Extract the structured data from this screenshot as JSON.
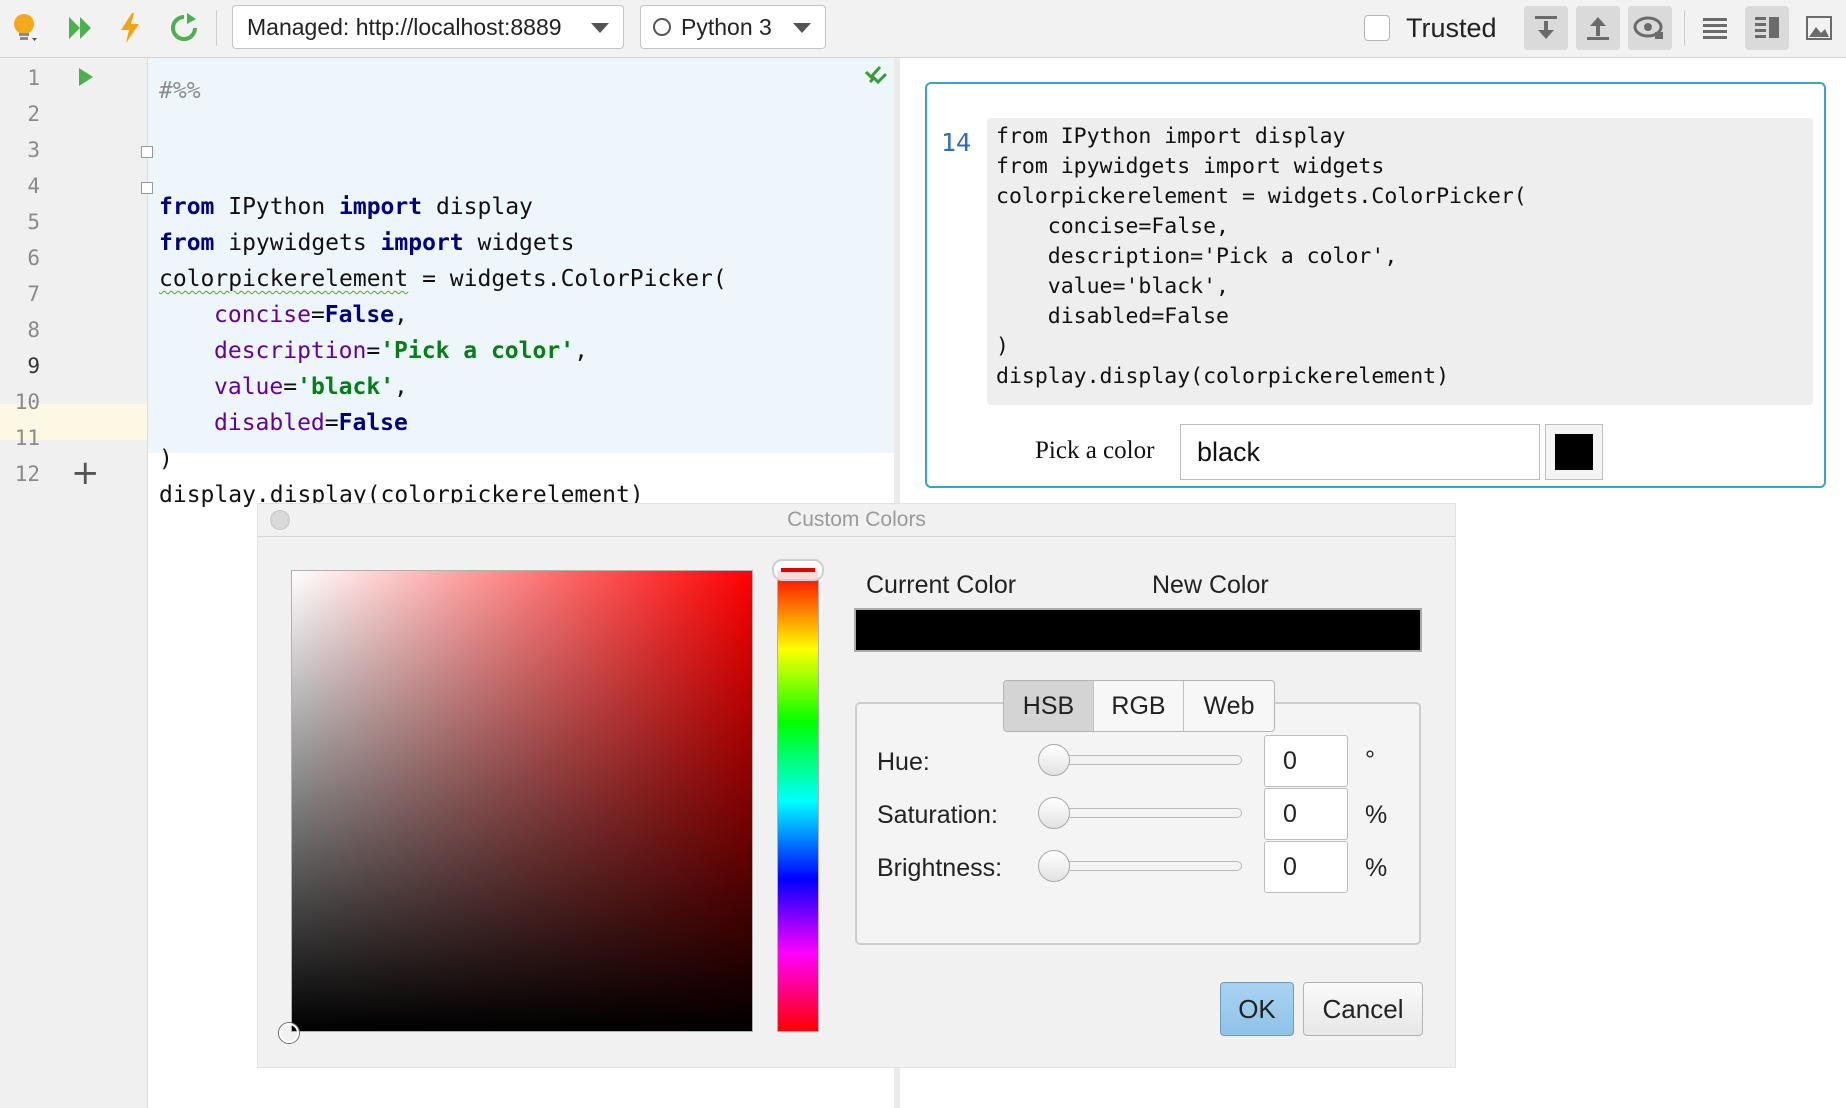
{
  "toolbar": {
    "server_combo": "Managed: http://localhost:8889",
    "kernel_combo": "Python 3",
    "trusted_label": "Trusted",
    "trusted_checked": false,
    "icons": [
      "lightbulb-icon",
      "run-all-icon",
      "run-lightning-icon",
      "restart-kernel-icon",
      "download-icon",
      "upload-icon",
      "preview-eye-icon",
      "list-view-icon",
      "split-view-icon",
      "image-view-icon"
    ]
  },
  "editor": {
    "line_numbers": [
      "1",
      "2",
      "3",
      "4",
      "5",
      "6",
      "7",
      "8",
      "9",
      "10",
      "11",
      "12"
    ],
    "current_line": "9",
    "lines": {
      "l1": "#%%",
      "l3_kw1": "from",
      "l3_mod": " IPython ",
      "l3_kw2": "import",
      "l3_name": " display",
      "l4_kw1": "from",
      "l4_mod": " ipywidgets ",
      "l4_kw2": "import",
      "l4_name": " widgets",
      "l5_var": "colorpickerelement",
      "l5_rest": " = widgets.ColorPicker(",
      "l6_param": "concise",
      "l6_eq": "=",
      "l6_val": "False",
      "l6_end": ",",
      "l7_param": "description",
      "l7_eq": "=",
      "l7_val": "'Pick a color'",
      "l7_end": ",",
      "l8_param": "value",
      "l8_eq": "=",
      "l8_val": "'black'",
      "l8_end": ",",
      "l9_param": "disabled",
      "l9_eq": "=",
      "l9_val": "False",
      "l10": ")",
      "l11": "display.display(colorpickerelement)"
    }
  },
  "output": {
    "exec_count": "14",
    "code_lines": [
      "from IPython import display",
      "from ipywidgets import widgets",
      "colorpickerelement = widgets.ColorPicker(",
      "    concise=False,",
      "    description='Pick a color',",
      "    value='black',",
      "    disabled=False",
      ")",
      "display.display(colorpickerelement)"
    ],
    "widget_label": "Pick a color",
    "widget_value": "black",
    "widget_color": "#000000"
  },
  "dialog": {
    "title": "Custom Colors",
    "current_color_label": "Current Color",
    "new_color_label": "New Color",
    "tabs": [
      "HSB",
      "RGB",
      "Web"
    ],
    "active_tab": "HSB",
    "hue_label": "Hue:",
    "hue_value": "0",
    "hue_unit": "°",
    "saturation_label": "Saturation:",
    "saturation_value": "0",
    "saturation_unit": "%",
    "brightness_label": "Brightness:",
    "brightness_value": "0",
    "brightness_unit": "%",
    "ok_label": "OK",
    "cancel_label": "Cancel"
  },
  "colors": {
    "accent": "#3aa3c9",
    "keyword": "#000080",
    "param": "#660099",
    "string": "#067d17",
    "cell_bg": "#edf6fb"
  }
}
